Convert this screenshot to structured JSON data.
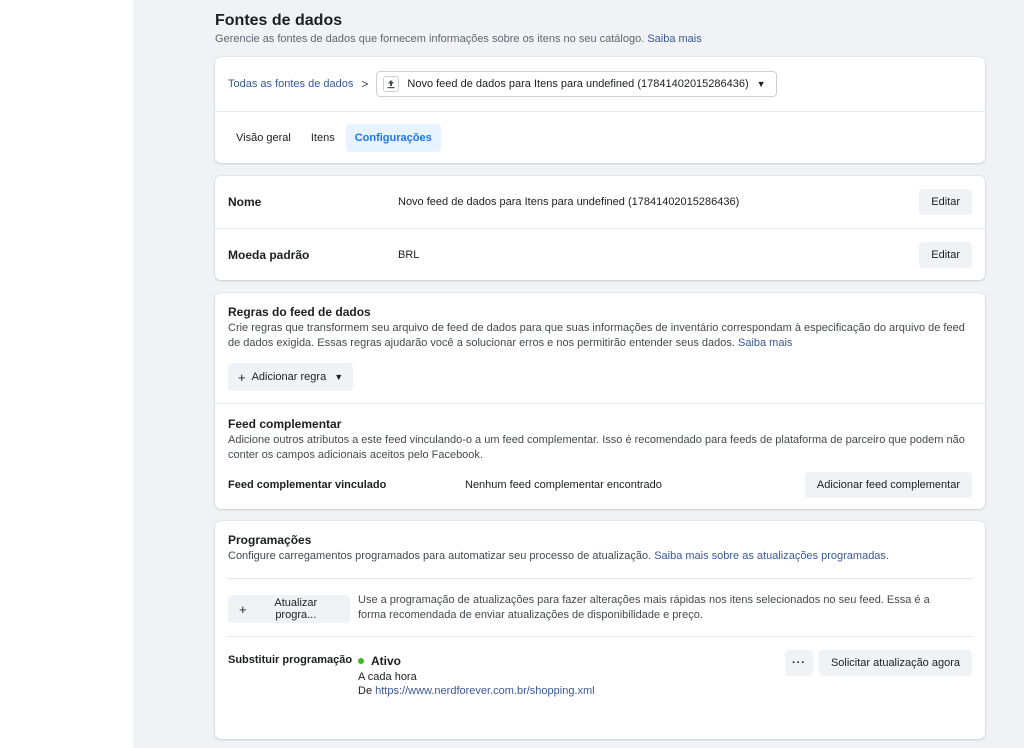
{
  "page": {
    "title": "Fontes de dados",
    "subtitle": "Gerencie as fontes de dados que fornecem informações sobre os itens no seu catálogo.",
    "subtitle_link": "Saiba mais"
  },
  "breadcrumb": {
    "root": "Todas as fontes de dados",
    "separator": ">",
    "current": "Novo feed de dados para Itens para undefined (17841402015286436)"
  },
  "tabs": [
    {
      "label": "Visão geral"
    },
    {
      "label": "Itens"
    },
    {
      "label": "Configurações",
      "active": true
    }
  ],
  "properties": [
    {
      "label": "Nome",
      "value": "Novo feed de dados para Itens para undefined (17841402015286436)",
      "button": "Editar"
    },
    {
      "label": "Moeda padrão",
      "value": "BRL",
      "button": "Editar"
    }
  ],
  "rules": {
    "title": "Regras do feed de dados",
    "desc": "Crie regras que transformem seu arquivo de feed de dados para que suas informações de inventário correspondam à especificação do arquivo de feed de dados exigida. Essas regras ajudarão você a solucionar erros e nos permitirão entender seus dados.",
    "link": "Saiba mais",
    "add_button": "Adicionar regra"
  },
  "supplemental": {
    "title": "Feed complementar",
    "desc": "Adicione outros atributos a este feed vinculando-o a um feed complementar. Isso é recomendado para feeds de plataforma de parceiro que podem não conter os campos adicionais aceitos pelo Facebook.",
    "linked_label": "Feed complementar vinculado",
    "linked_value": "Nenhum feed complementar encontrado",
    "add_button": "Adicionar feed complementar"
  },
  "schedules": {
    "title": "Programações",
    "desc": "Configure carregamentos programados para automatizar seu processo de atualização.",
    "link": "Saiba mais sobre as atualizações programadas.",
    "update_button": "Atualizar progra...",
    "update_desc": "Use a programação de atualizações para fazer alterações mais rápidas nos itens selecionados no seu feed. Essa é a forma recomendada de enviar atualizações de disponibilidade e preço.",
    "replace_label": "Substituir programação",
    "status": "Ativo",
    "frequency": "A cada hora",
    "url_prefix": "De",
    "url": "https://www.nerdforever.com.br/shopping.xml",
    "more_button": "···",
    "request_button": "Solicitar atualização agora"
  },
  "colors": {
    "accent": "#1877f2",
    "link": "#385898",
    "status_active": "#42b72a",
    "background": "#f0f2f5"
  }
}
